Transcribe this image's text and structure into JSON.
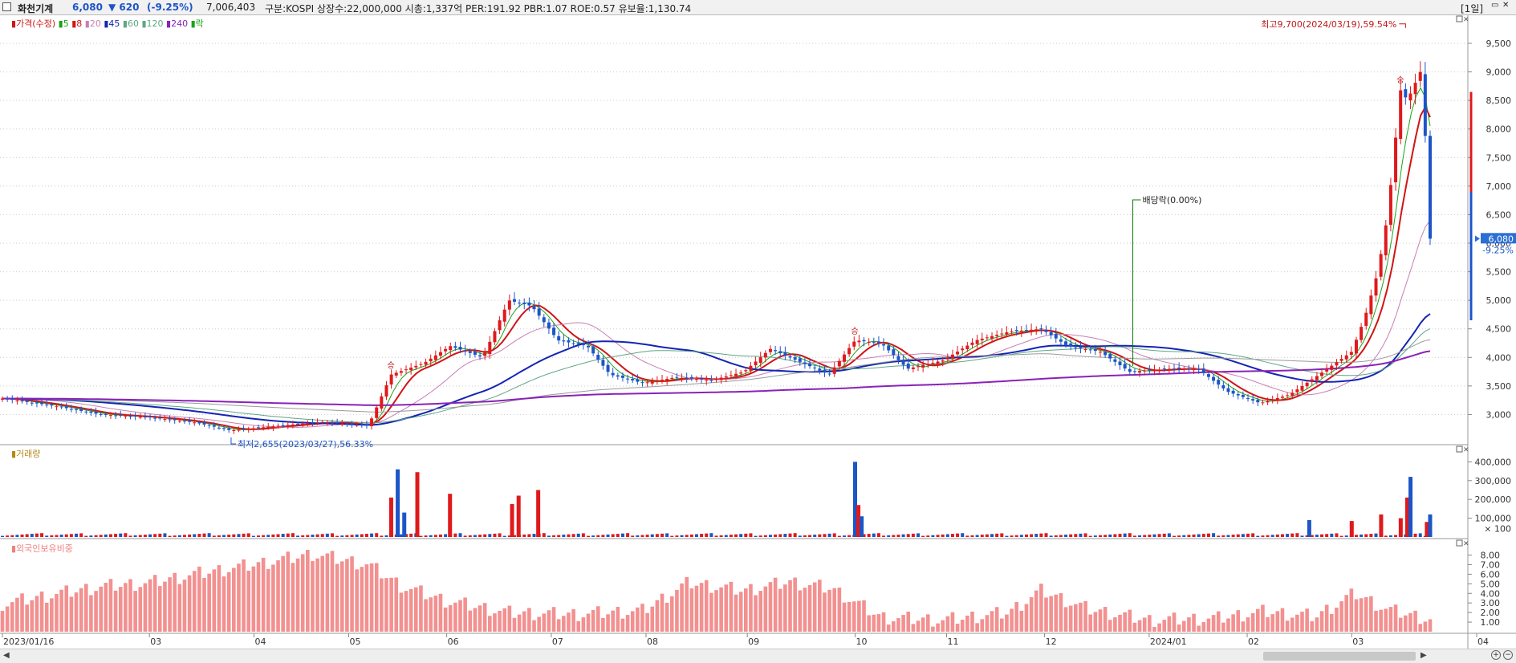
{
  "header": {
    "stock_name": "화천기계",
    "price": "6,080",
    "change": "▼ 620",
    "change_pct": "(-9.25%)",
    "volume": "7,006,403",
    "info": "구분:KOSPI 상장수:22,000,000 시총:1,337억 PER:191.92 PBR:1.07 ROE:0.57 유보율:1,130.74",
    "period": "[1일]"
  },
  "colors": {
    "up": "#e0191c",
    "down": "#1c55c8",
    "ma5": "#19a319",
    "ma8": "#d01515",
    "ma20": "#c87fb4",
    "ma45": "#1424b4",
    "ma60": "#5fa585",
    "ma120": "#9a9a9a",
    "ma240": "#8a22b8",
    "volume_up": "#e0191c",
    "volume_down": "#1c55c8",
    "foreign_bar": "#f39090",
    "current_tag_bg": "#2a6fd6"
  },
  "price_legend": {
    "main": "가격(수정)",
    "ma": [
      "5",
      "8",
      "20",
      "45",
      "60",
      "120",
      "240"
    ],
    "last": "락"
  },
  "volume_legend": "거래량",
  "foreign_legend": "외국인보유비중",
  "annotations": {
    "high": "최고9,700(2024/03/19),59.54%",
    "low": "최저2,655(2023/03/27),56.33%",
    "dividend": "배당락(0.00%)",
    "current_price": "6,080",
    "current_pct": "-9.25%",
    "rights_marker": "승"
  },
  "chart_data": [
    {
      "type": "candlestick",
      "title": "화천기계 가격(수정)",
      "x_labels": [
        "2023/01/16",
        "03",
        "04",
        "05",
        "06",
        "07",
        "08",
        "09",
        "10",
        "11",
        "12",
        "2024/01",
        "02",
        "03",
        "04"
      ],
      "y_ticks": [
        3000,
        3500,
        4000,
        4500,
        5000,
        5500,
        6000,
        6500,
        7000,
        7500,
        8000,
        8500,
        9000,
        9500
      ],
      "y_tick_labels": [
        "3,000",
        "3,500",
        "4,000",
        "4,500",
        "5,000",
        "5,500",
        "6,000",
        "6,500",
        "7,000",
        "7,500",
        "8,000",
        "8,500",
        "9,000",
        "9,500"
      ],
      "ylim": [
        2500,
        9950
      ],
      "close_series": [
        {
          "date": "2023-01-16",
          "close": 3280
        },
        {
          "date": "2023-02-01",
          "close": 3150
        },
        {
          "date": "2023-02-15",
          "close": 3000
        },
        {
          "date": "2023-03-02",
          "close": 2950
        },
        {
          "date": "2023-03-16",
          "close": 2860
        },
        {
          "date": "2023-03-27",
          "close": 2720
        },
        {
          "date": "2023-04-10",
          "close": 2800
        },
        {
          "date": "2023-04-24",
          "close": 2870
        },
        {
          "date": "2023-05-08",
          "close": 2800
        },
        {
          "date": "2023-05-15",
          "close": 3700
        },
        {
          "date": "2023-05-25",
          "close": 3900
        },
        {
          "date": "2023-06-02",
          "close": 4200
        },
        {
          "date": "2023-06-12",
          "close": 4000
        },
        {
          "date": "2023-06-20",
          "close": 5000
        },
        {
          "date": "2023-06-27",
          "close": 4900
        },
        {
          "date": "2023-07-05",
          "close": 4300
        },
        {
          "date": "2023-07-14",
          "close": 4200
        },
        {
          "date": "2023-07-21",
          "close": 3700
        },
        {
          "date": "2023-07-31",
          "close": 3550
        },
        {
          "date": "2023-08-10",
          "close": 3650
        },
        {
          "date": "2023-08-21",
          "close": 3600
        },
        {
          "date": "2023-08-31",
          "close": 3750
        },
        {
          "date": "2023-09-08",
          "close": 4150
        },
        {
          "date": "2023-09-18",
          "close": 3900
        },
        {
          "date": "2023-09-26",
          "close": 3700
        },
        {
          "date": "2023-10-04",
          "close": 4300
        },
        {
          "date": "2023-10-12",
          "close": 4250
        },
        {
          "date": "2023-10-20",
          "close": 3800
        },
        {
          "date": "2023-10-31",
          "close": 3950
        },
        {
          "date": "2023-11-10",
          "close": 4300
        },
        {
          "date": "2023-11-20",
          "close": 4450
        },
        {
          "date": "2023-11-30",
          "close": 4500
        },
        {
          "date": "2023-12-08",
          "close": 4200
        },
        {
          "date": "2023-12-18",
          "close": 4100
        },
        {
          "date": "2023-12-27",
          "close": 3750
        },
        {
          "date": "2024-01-08",
          "close": 3800
        },
        {
          "date": "2024-01-17",
          "close": 3800
        },
        {
          "date": "2024-01-26",
          "close": 3400
        },
        {
          "date": "2024-02-05",
          "close": 3200
        },
        {
          "date": "2024-02-14",
          "close": 3350
        },
        {
          "date": "2024-02-23",
          "close": 3700
        },
        {
          "date": "2024-03-04",
          "close": 4100
        },
        {
          "date": "2024-03-08",
          "close": 4700
        },
        {
          "date": "2024-03-12",
          "close": 5500
        },
        {
          "date": "2024-03-15",
          "close": 6500
        },
        {
          "date": "2024-03-19",
          "close": 8700
        },
        {
          "date": "2024-03-21",
          "close": 8500
        },
        {
          "date": "2024-03-25",
          "close": 9000
        },
        {
          "date": "2024-03-27",
          "close": 7500
        },
        {
          "date": "2024-03-28",
          "close": 6080
        }
      ],
      "high": {
        "value": 9700,
        "date": "2024/03/19"
      },
      "low": {
        "value": 2655,
        "date": "2023/03/27"
      },
      "moving_averages": [
        "5",
        "8",
        "20",
        "45",
        "60",
        "120",
        "240"
      ]
    },
    {
      "type": "bar",
      "title": "거래량",
      "y_ticks": [
        100000,
        200000,
        300000,
        400000
      ],
      "y_tick_labels": [
        "100,000",
        "200,000",
        "300,000",
        "400,000"
      ],
      "ylim": [
        0,
        470000
      ],
      "y_tick_suffix_label": "× 100",
      "spikes": [
        {
          "date": "2023-05-15",
          "value": 210000,
          "dir": "up"
        },
        {
          "date": "2023-05-17",
          "value": 360000,
          "dir": "down"
        },
        {
          "date": "2023-05-19",
          "value": 130000,
          "dir": "down"
        },
        {
          "date": "2023-05-23",
          "value": 345000,
          "dir": "up"
        },
        {
          "date": "2023-06-02",
          "value": 230000,
          "dir": "up"
        },
        {
          "date": "2023-06-21",
          "value": 175000,
          "dir": "up"
        },
        {
          "date": "2023-06-23",
          "value": 220000,
          "dir": "up"
        },
        {
          "date": "2023-06-29",
          "value": 250000,
          "dir": "up"
        },
        {
          "date": "2023-10-04",
          "value": 400000,
          "dir": "down"
        },
        {
          "date": "2023-10-05",
          "value": 170000,
          "dir": "up"
        },
        {
          "date": "2023-10-06",
          "value": 110000,
          "dir": "down"
        },
        {
          "date": "2024-02-20",
          "value": 90000,
          "dir": "down"
        },
        {
          "date": "2024-03-04",
          "value": 85000,
          "dir": "up"
        },
        {
          "date": "2024-03-13",
          "value": 120000,
          "dir": "up"
        },
        {
          "date": "2024-03-19",
          "value": 100000,
          "dir": "up"
        },
        {
          "date": "2024-03-21",
          "value": 210000,
          "dir": "up"
        },
        {
          "date": "2024-03-22",
          "value": 320000,
          "dir": "down"
        },
        {
          "date": "2024-03-27",
          "value": 80000,
          "dir": "up"
        },
        {
          "date": "2024-03-28",
          "value": 120000,
          "dir": "down"
        }
      ]
    },
    {
      "type": "bar",
      "title": "외국인보유비중",
      "y_ticks": [
        1,
        2,
        3,
        4,
        5,
        6,
        7,
        8
      ],
      "y_tick_labels": [
        "1.00",
        "2.00",
        "3.00",
        "4.00",
        "5.00",
        "6.00",
        "7.00",
        "8.00"
      ],
      "ylim": [
        0,
        9.3
      ],
      "series": [
        {
          "date": "2023-01-16",
          "value": 2.9
        },
        {
          "date": "2023-02-01",
          "value": 3.9
        },
        {
          "date": "2023-02-15",
          "value": 4.7
        },
        {
          "date": "2023-03-02",
          "value": 5.1
        },
        {
          "date": "2023-03-16",
          "value": 6.0
        },
        {
          "date": "2023-04-03",
          "value": 7.0
        },
        {
          "date": "2023-04-21",
          "value": 8.1
        },
        {
          "date": "2023-05-08",
          "value": 7.0
        },
        {
          "date": "2023-05-18",
          "value": 4.8
        },
        {
          "date": "2023-06-01",
          "value": 3.2
        },
        {
          "date": "2023-06-20",
          "value": 2.0
        },
        {
          "date": "2023-07-10",
          "value": 1.8
        },
        {
          "date": "2023-07-31",
          "value": 2.2
        },
        {
          "date": "2023-08-14",
          "value": 5.1
        },
        {
          "date": "2023-08-31",
          "value": 4.3
        },
        {
          "date": "2023-09-14",
          "value": 5.2
        },
        {
          "date": "2023-09-27",
          "value": 4.5
        },
        {
          "date": "2023-10-12",
          "value": 1.5
        },
        {
          "date": "2023-10-31",
          "value": 1.2
        },
        {
          "date": "2023-11-20",
          "value": 2.0
        },
        {
          "date": "2023-11-30",
          "value": 4.3
        },
        {
          "date": "2023-12-14",
          "value": 2.4
        },
        {
          "date": "2024-01-02",
          "value": 1.2
        },
        {
          "date": "2024-01-23",
          "value": 1.4
        },
        {
          "date": "2024-02-06",
          "value": 2.1
        },
        {
          "date": "2024-02-22",
          "value": 1.6
        },
        {
          "date": "2024-03-05",
          "value": 4.0
        },
        {
          "date": "2024-03-15",
          "value": 2.3
        },
        {
          "date": "2024-03-28",
          "value": 1.3
        }
      ]
    }
  ]
}
